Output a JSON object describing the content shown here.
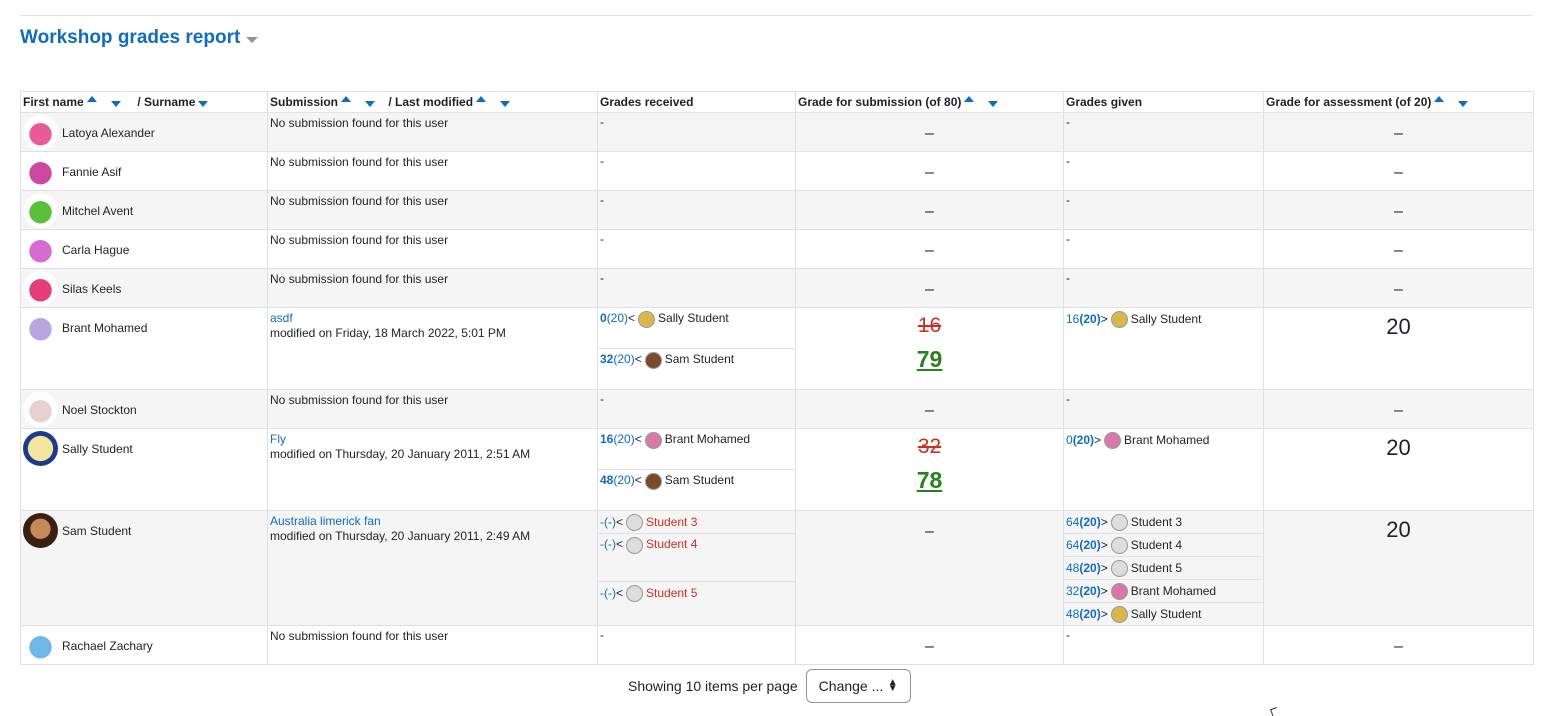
{
  "header": {
    "title": "Workshop grades report"
  },
  "columns": {
    "first_name": "First name",
    "surname": "/ Surname",
    "submission": "Submission",
    "last_modified": "/ Last modified",
    "grades_received": "Grades received",
    "grade_submission": "Grade for submission (of 80)",
    "grades_given": "Grades given",
    "grade_assessment": "Grade for assessment (of 20)"
  },
  "colors": {
    "link": "#0f6cbf",
    "over": "#ca3120",
    "final": "#2a7f1f"
  },
  "rows": [
    {
      "name": "Latoya Alexander",
      "submission": "No submission found for this user",
      "received": "-",
      "grade": "–",
      "given": "-",
      "assessment": "–"
    },
    {
      "name": "Fannie Asif",
      "submission": "No submission found for this user",
      "received": "-",
      "grade": "–",
      "given": "-",
      "assessment": "–"
    },
    {
      "name": "Mitchel Avent",
      "submission": "No submission found for this user",
      "received": "-",
      "grade": "–",
      "given": "-",
      "assessment": "–"
    },
    {
      "name": "Carla Hague",
      "submission": "No submission found for this user",
      "received": "-",
      "grade": "–",
      "given": "-",
      "assessment": "–"
    },
    {
      "name": "Silas Keels",
      "submission": "No submission found for this user",
      "received": "-",
      "grade": "–",
      "given": "-",
      "assessment": "–"
    },
    {
      "name": "Brant Mohamed",
      "sub_title": "asdf",
      "modified": "modified on Friday, 18 March 2022, 5:01 PM",
      "received": [
        {
          "g": "0",
          "w": "(20)",
          "arrow": "<",
          "who": "Sally Student"
        },
        {
          "g": "32",
          "w": "(20)",
          "arrow": "<",
          "who": "Sam Student"
        }
      ],
      "grade_old": "16",
      "grade_new": "79",
      "given": [
        {
          "g": "16",
          "w": "(20)",
          "arrow": ">",
          "who": "Sally Student"
        }
      ],
      "assessment": "20"
    },
    {
      "name": "Noel Stockton",
      "submission": "No submission found for this user",
      "received": "-",
      "grade": "–",
      "given": "-",
      "assessment": "–"
    },
    {
      "name": "Sally Student",
      "sub_title": "Fly",
      "modified": "modified on Thursday, 20 January 2011, 2:51 AM",
      "received": [
        {
          "g": "16",
          "w": "(20)",
          "arrow": "<",
          "who": "Brant Mohamed"
        },
        {
          "g": "48",
          "w": "(20)",
          "arrow": "<",
          "who": "Sam Student"
        }
      ],
      "grade_old": "32",
      "grade_new": "78",
      "given": [
        {
          "g": "0",
          "w": "(20)",
          "arrow": ">",
          "who": "Brant Mohamed"
        }
      ],
      "assessment": "20"
    },
    {
      "name": "Sam Student",
      "sub_title": "Australia limerick fan",
      "modified": "modified on Thursday, 20 January 2011, 2:49 AM",
      "received": [
        {
          "g": "-",
          "w": "(-)",
          "arrow": "<",
          "who": "Student 3"
        },
        {
          "g": "-",
          "w": "(-)",
          "arrow": "<",
          "who": "Student 4"
        },
        {
          "g": "-",
          "w": "(-)",
          "arrow": "<",
          "who": "Student 5"
        }
      ],
      "grade": "–",
      "given": [
        {
          "g": "64",
          "w": "(20)",
          "arrow": ">",
          "who": "Student 3"
        },
        {
          "g": "64",
          "w": "(20)",
          "arrow": ">",
          "who": "Student 4"
        },
        {
          "g": "48",
          "w": "(20)",
          "arrow": ">",
          "who": "Student 5"
        },
        {
          "g": "32",
          "w": "(20)",
          "arrow": ">",
          "who": "Brant Mohamed"
        },
        {
          "g": "48",
          "w": "(20)",
          "arrow": ">",
          "who": "Sally Student"
        }
      ],
      "assessment": "20"
    },
    {
      "name": "Rachael Zachary",
      "submission": "No submission found for this user",
      "received": "-",
      "grade": "–",
      "given": "-",
      "assessment": "–"
    }
  ],
  "footer": {
    "showing": "Showing 10 items per page",
    "change": "Change ..."
  }
}
